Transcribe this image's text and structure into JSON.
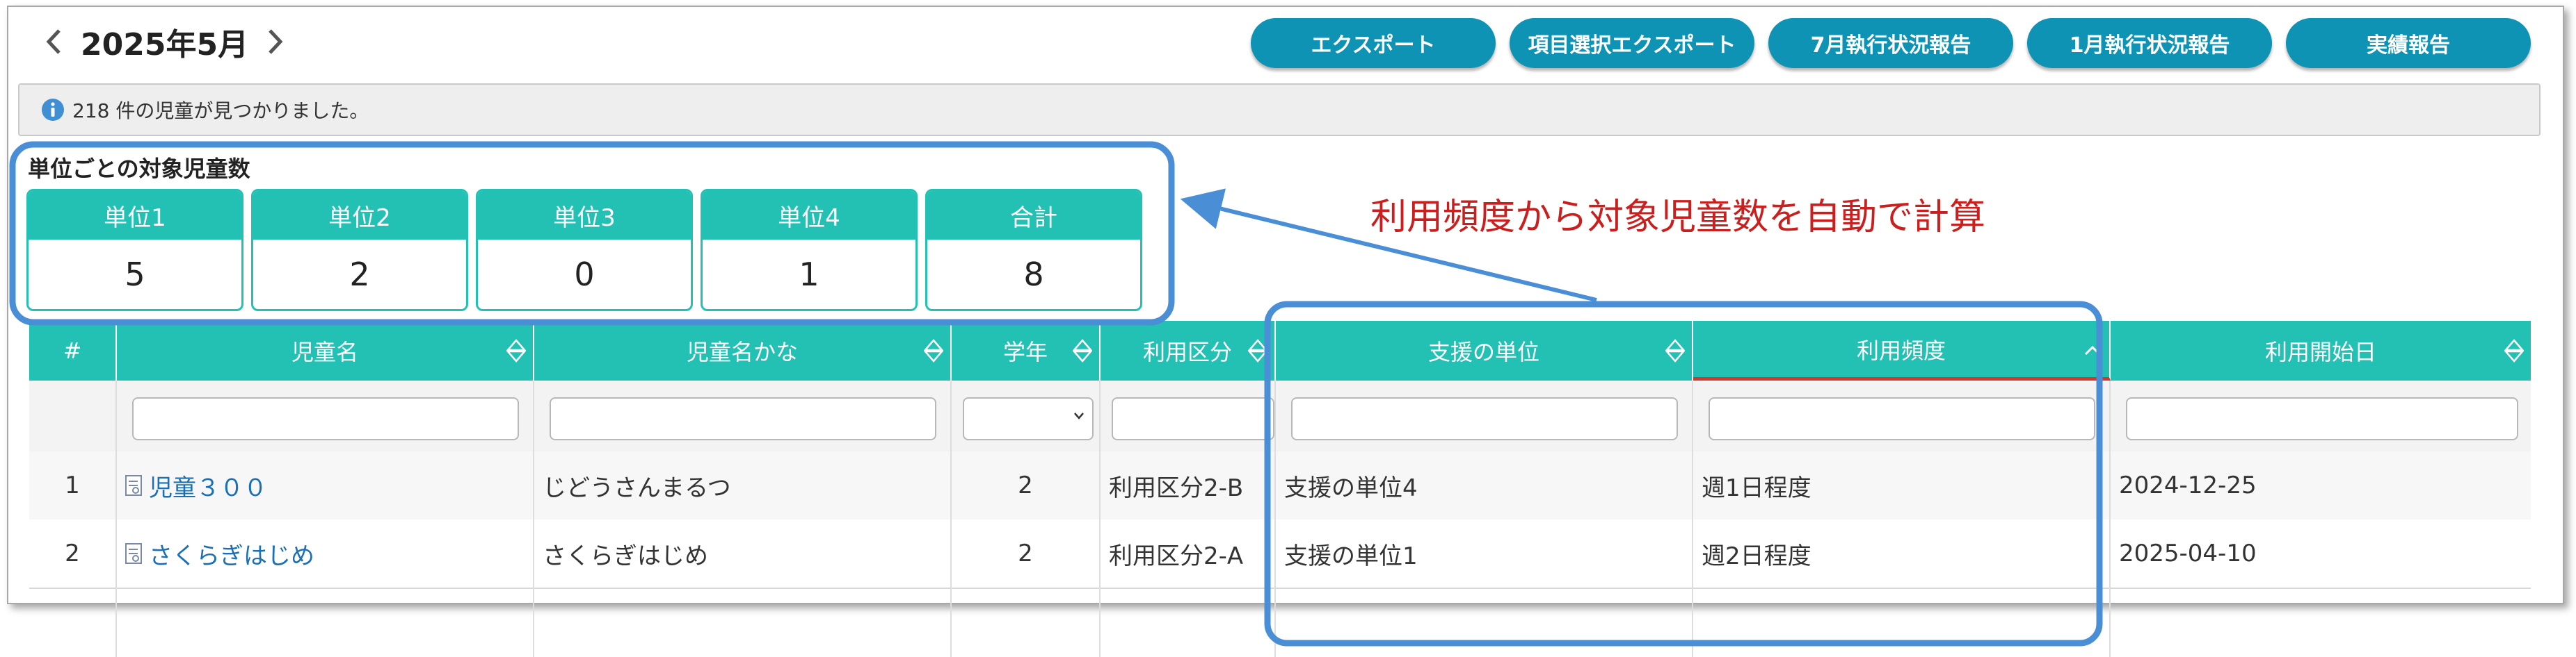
{
  "header": {
    "month_label": "2025年5月",
    "prev_icon": "chevron-left-icon",
    "next_icon": "chevron-right-icon"
  },
  "toolbar": {
    "buttons": [
      "エクスポート",
      "項目選択エクスポート",
      "7月執行状況報告",
      "1月執行状況報告",
      "実績報告"
    ]
  },
  "info": {
    "icon": "info-icon",
    "text": "218 件の児童が見つかりました。"
  },
  "units": {
    "title": "単位ごとの対象児童数",
    "cards": [
      {
        "label": "単位1",
        "value": "5"
      },
      {
        "label": "単位2",
        "value": "2"
      },
      {
        "label": "単位3",
        "value": "0"
      },
      {
        "label": "単位4",
        "value": "1"
      },
      {
        "label": "合計",
        "value": "8"
      }
    ]
  },
  "annotation": {
    "text": "利用頻度から対象児童数を自動で計算",
    "color": "#c9201f",
    "highlight_color": "#4a8fd6"
  },
  "table": {
    "columns": [
      "#",
      "児童名",
      "児童名かな",
      "学年",
      "利用区分",
      "支援の単位",
      "利用頻度",
      "利用開始日"
    ],
    "rows": [
      {
        "no": "1",
        "name": "児童３００",
        "kana": "じどうさんまるつ",
        "grade": "2",
        "category": "利用区分2-B",
        "unit": "支援の単位4",
        "frequency": "週1日程度",
        "start": "2024-12-25"
      },
      {
        "no": "2",
        "name": "さくらぎはじめ",
        "kana": "さくらぎはじめ",
        "grade": "2",
        "category": "利用区分2-A",
        "unit": "支援の単位1",
        "frequency": "週2日程度",
        "start": "2025-04-10"
      }
    ]
  },
  "colors": {
    "accent_teal": "#22c1b4",
    "button_blue": "#0e93b5",
    "link_blue": "#1a6fb5"
  }
}
